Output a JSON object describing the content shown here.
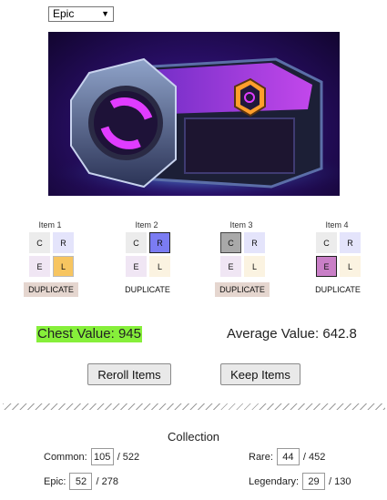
{
  "rarity_select": {
    "value": "Epic"
  },
  "items": [
    {
      "title": "Item 1",
      "labels": [
        "C",
        "R",
        "E",
        "L"
      ],
      "selected": "L",
      "duplicate": "DUPLICATE",
      "duplicate_highlight": true
    },
    {
      "title": "Item 2",
      "labels": [
        "C",
        "R",
        "E",
        "L"
      ],
      "selected": "R",
      "duplicate": "DUPLICATE",
      "duplicate_highlight": false
    },
    {
      "title": "Item 3",
      "labels": [
        "C",
        "R",
        "E",
        "L"
      ],
      "selected": "C",
      "duplicate": "DUPLICATE",
      "duplicate_highlight": true
    },
    {
      "title": "Item 4",
      "labels": [
        "C",
        "R",
        "E",
        "L"
      ],
      "selected": "E",
      "duplicate": "DUPLICATE",
      "duplicate_highlight": false
    }
  ],
  "chest_value": "Chest Value: 945",
  "average_value": "Average Value: 642.8",
  "buttons": {
    "reroll": "Reroll Items",
    "keep": "Keep Items"
  },
  "collection": {
    "title": "Collection",
    "common": {
      "label": "Common:",
      "value": "105",
      "total": "/ 522"
    },
    "rare": {
      "label": "Rare:",
      "value": "44",
      "total": "/ 452"
    },
    "epic": {
      "label": "Epic:",
      "value": "52",
      "total": "/ 278"
    },
    "legendary": {
      "label": "Legendary:",
      "value": "29",
      "total": "/ 130"
    }
  }
}
